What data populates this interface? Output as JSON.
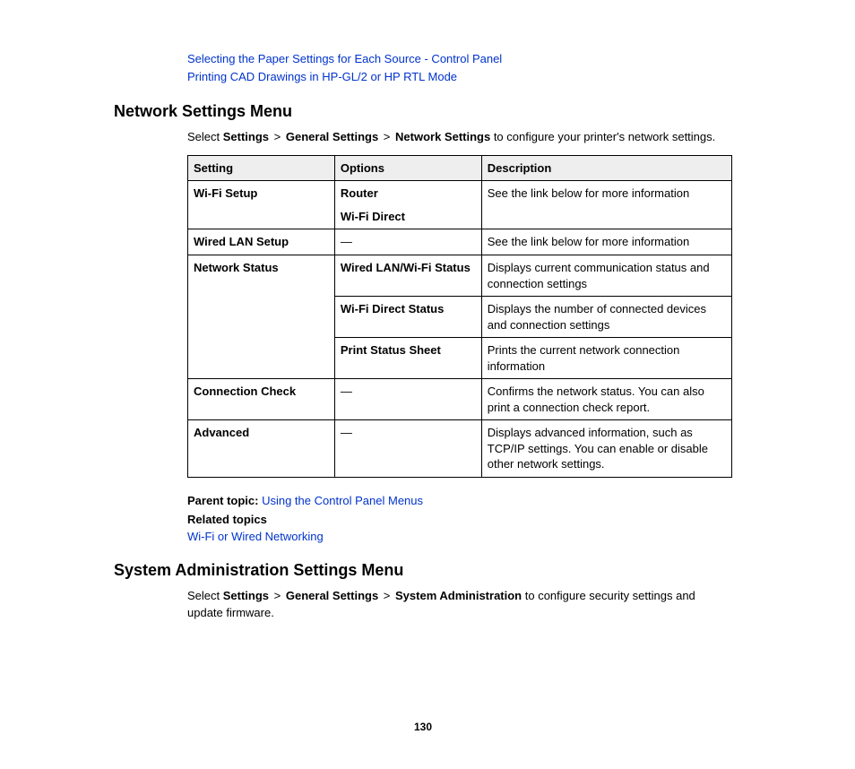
{
  "top_links": {
    "link1": "Selecting the Paper Settings for Each Source - Control Panel",
    "link2": "Printing CAD Drawings in HP-GL/2 or HP RTL Mode"
  },
  "section1": {
    "heading": "Network Settings Menu",
    "intro_pre": "Select ",
    "intro_b1": "Settings",
    "intro_b2": "General Settings",
    "intro_b3": "Network Settings",
    "intro_post": " to configure your printer's network settings.",
    "th_setting": "Setting",
    "th_options": "Options",
    "th_description": "Description",
    "r1_setting": "Wi-Fi Setup",
    "r1_opt1": "Router",
    "r1_opt2": "Wi-Fi Direct",
    "r1_desc": "See the link below for more information",
    "r2_setting": "Wired LAN Setup",
    "r2_opt": "—",
    "r2_desc": "See the link below for more information",
    "r3_setting": "Network Status",
    "r3a_opt": "Wired LAN/Wi-Fi Status",
    "r3a_desc": "Displays current communication status and connection settings",
    "r3b_opt": "Wi-Fi Direct Status",
    "r3b_desc": "Displays the number of connected devices and connection settings",
    "r3c_opt": "Print Status Sheet",
    "r3c_desc": "Prints the current network connection information",
    "r4_setting": "Connection Check",
    "r4_opt": "—",
    "r4_desc": "Confirms the network status. You can also print a connection check report.",
    "r5_setting": "Advanced",
    "r5_opt": "—",
    "r5_desc": "Displays advanced information, such as TCP/IP settings. You can enable or disable other network settings.",
    "parent_label": "Parent topic: ",
    "parent_link": "Using the Control Panel Menus",
    "related_title": "Related topics",
    "related_link": "Wi-Fi or Wired Networking"
  },
  "section2": {
    "heading": "System Administration Settings Menu",
    "intro_pre": "Select ",
    "intro_b1": "Settings",
    "intro_b2": "General Settings",
    "intro_b3": "System Administration",
    "intro_post": " to configure security settings and update firmware."
  },
  "page_number": "130"
}
